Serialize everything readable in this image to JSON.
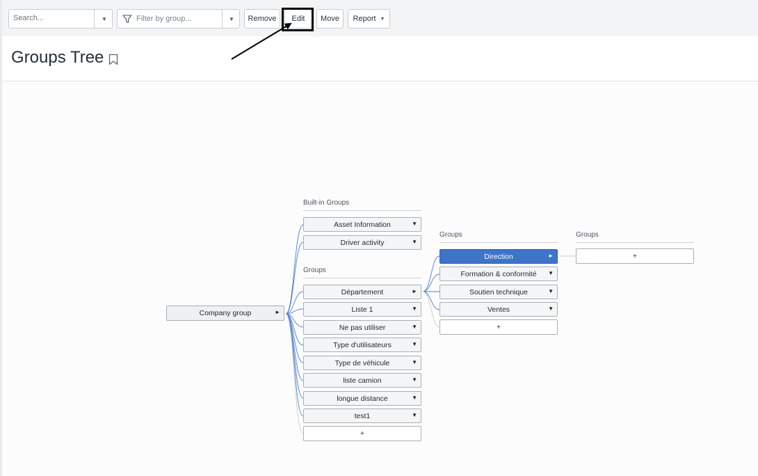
{
  "toolbar": {
    "search_placeholder": "Search...",
    "filter_placeholder": "Filter by group...",
    "remove_label": "Remove",
    "edit_label": "Edit",
    "move_label": "Move",
    "report_label": "Report"
  },
  "page": {
    "title": "Groups Tree"
  },
  "tree": {
    "root": "Company group",
    "builtin": {
      "title": "Built-in Groups",
      "items": [
        "Asset Information",
        "Driver activity"
      ]
    },
    "groups": {
      "title": "Groups",
      "items": [
        "Département",
        "Liste 1",
        "Ne pas utiliser",
        "Type d'utilisateurs",
        "Type de véhicule",
        "liste camion",
        "longue distance",
        "test1"
      ],
      "add": "+"
    },
    "sub_groups": {
      "title": "Groups",
      "items": [
        "Direction",
        "Formation & conformité",
        "Soutien technique",
        "Ventes"
      ],
      "add": "+"
    },
    "sub_sub_groups": {
      "title": "Groups",
      "add": "+"
    }
  },
  "colors": {
    "selected": "#3f74c9",
    "links": "#4a7fd0"
  }
}
